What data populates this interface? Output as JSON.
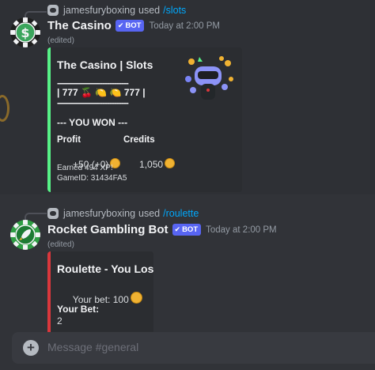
{
  "messages": [
    {
      "reply": {
        "user": "jamesfuryboxing",
        "used": "used",
        "command": "/slots"
      },
      "author": "The Casino",
      "bot_tag": "BOT",
      "timestamp": "Today at 2:00 PM",
      "edited": "(edited)",
      "embed": {
        "color": "#57f287",
        "title": "The Casino | Slots",
        "divider": "------------------------------",
        "reels": "| 777 🍒 🍋 🍋 777 |",
        "result": "--- YOU WON ---",
        "fields": [
          {
            "name": "Profit",
            "value": "+50 (+0)"
          },
          {
            "name": "Credits",
            "value": "1,050"
          }
        ],
        "xp": "Earned 494 XP!",
        "game_id": "GameID: 31434FA5"
      }
    },
    {
      "reply": {
        "user": "jamesfuryboxing",
        "used": "used",
        "command": "/roulette"
      },
      "author": "Rocket Gambling Bot",
      "bot_tag": "BOT",
      "timestamp": "Today at 2:00 PM",
      "edited": "(edited)",
      "embed": {
        "color": "#da373c",
        "title": "Roulette - You Lost!",
        "bet_line": "Your bet: 100",
        "field_name": "Your Bet:",
        "field_value": "2"
      }
    }
  ],
  "composer": {
    "placeholder": "Message #general"
  },
  "icons": [
    "discord-app-icon",
    "dollar-chip-avatar",
    "rocket-chip-avatar",
    "verified-check-icon",
    "coin-icon",
    "slot-bot-thumbnail",
    "plus-circle-icon"
  ]
}
